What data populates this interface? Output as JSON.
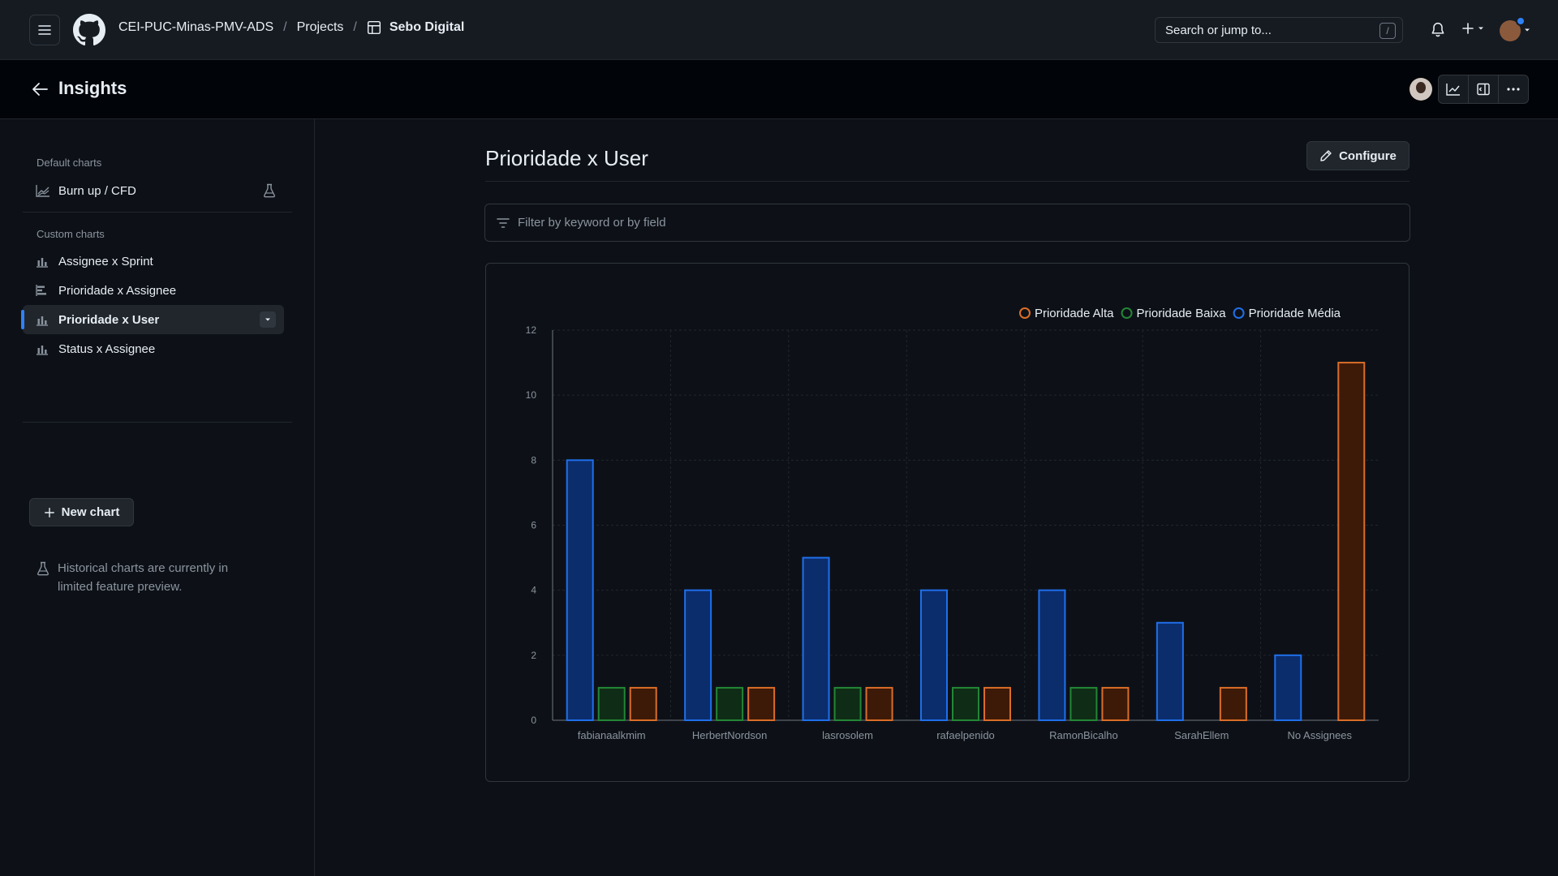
{
  "header": {
    "org": "CEI-PUC-Minas-PMV-ADS",
    "projects": "Projects",
    "project_name": "Sebo Digital",
    "search_placeholder": "Search or jump to...",
    "search_shortcut": "/"
  },
  "insights": {
    "title": "Insights"
  },
  "sidebar": {
    "default_heading": "Default charts",
    "default_items": [
      {
        "label": "Burn up / CFD",
        "icon": "graph-icon"
      }
    ],
    "custom_heading": "Custom charts",
    "custom_items": [
      {
        "label": "Assignee x Sprint",
        "icon": "bar-chart-icon"
      },
      {
        "label": "Prioridade x Assignee",
        "icon": "horizontal-bar-icon"
      },
      {
        "label": "Prioridade x User",
        "icon": "bar-chart-icon",
        "active": true
      },
      {
        "label": "Status x Assignee",
        "icon": "bar-chart-icon"
      }
    ],
    "new_chart": "New chart",
    "preview_note": "Historical charts are currently in limited feature preview."
  },
  "main": {
    "title": "Prioridade x User",
    "configure": "Configure",
    "filter_placeholder": "Filter by keyword or by field"
  },
  "colors": {
    "alta": "#db6d28",
    "baixa": "#238636",
    "media": "#1f6feb"
  },
  "chart_data": {
    "type": "bar",
    "categories": [
      "fabianaalkmim",
      "HerbertNordson",
      "lasrosolem",
      "rafaelpenido",
      "RamonBicalho",
      "SarahEllem",
      "No Assignees"
    ],
    "series": [
      {
        "name": "Prioridade Média",
        "values": [
          8,
          4,
          5,
          4,
          4,
          3,
          2
        ],
        "stroke": "#1f6feb",
        "fill": "#0c2d6b"
      },
      {
        "name": "Prioridade Baixa",
        "values": [
          1,
          1,
          1,
          1,
          1,
          0,
          0
        ],
        "stroke": "#238636",
        "fill": "#0f2d16"
      },
      {
        "name": "Prioridade Alta",
        "values": [
          1,
          1,
          1,
          1,
          1,
          1,
          11
        ],
        "stroke": "#db6d28",
        "fill": "#3d1a08"
      }
    ],
    "legend": [
      {
        "name": "Prioridade Alta",
        "color": "#db6d28"
      },
      {
        "name": "Prioridade Baixa",
        "color": "#238636"
      },
      {
        "name": "Prioridade Média",
        "color": "#1f6feb"
      }
    ],
    "legend_position": "top-right",
    "ylim": [
      0,
      12
    ],
    "yticks": [
      0,
      2,
      4,
      6,
      8,
      10,
      12
    ],
    "grid": true
  }
}
